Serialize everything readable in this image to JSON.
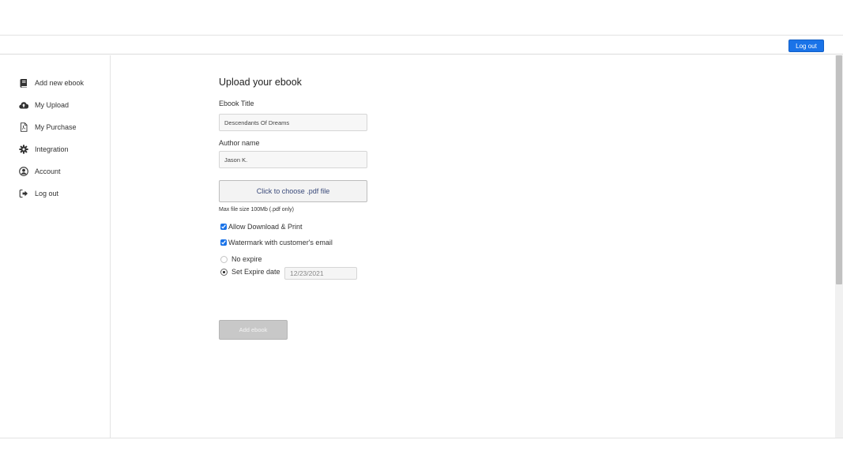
{
  "header": {
    "logout_label": "Log out"
  },
  "sidebar": {
    "items": [
      {
        "label": "Add new ebook",
        "icon": "book-icon"
      },
      {
        "label": "My Upload",
        "icon": "cloud-upload-icon"
      },
      {
        "label": "My Purchase",
        "icon": "pdf-file-icon"
      },
      {
        "label": "Integration",
        "icon": "gear-icon"
      },
      {
        "label": "Account",
        "icon": "user-circle-icon"
      },
      {
        "label": "Log out",
        "icon": "sign-out-icon"
      }
    ]
  },
  "form": {
    "title": "Upload your ebook",
    "ebook_title_label": "Ebook Title",
    "ebook_title_value": "Descendants Of Dreams",
    "author_label": "Author name",
    "author_value": "Jason K.",
    "file_button": "Click to choose .pdf file",
    "file_hint": "Max file size 100Mb (.pdf only)",
    "allow_download_label": "Allow Download & Print",
    "allow_download_checked": true,
    "watermark_label": "Watermark with customer's email",
    "watermark_checked": true,
    "no_expire_label": "No expire",
    "set_expire_label": "Set Expire date",
    "selected_expire_option": "Set Expire date",
    "expire_date_value": "12/23/2021",
    "submit_label": "Add ebook"
  },
  "colors": {
    "accent": "#1a73e8",
    "disabled_button": "#c8c8c8"
  }
}
